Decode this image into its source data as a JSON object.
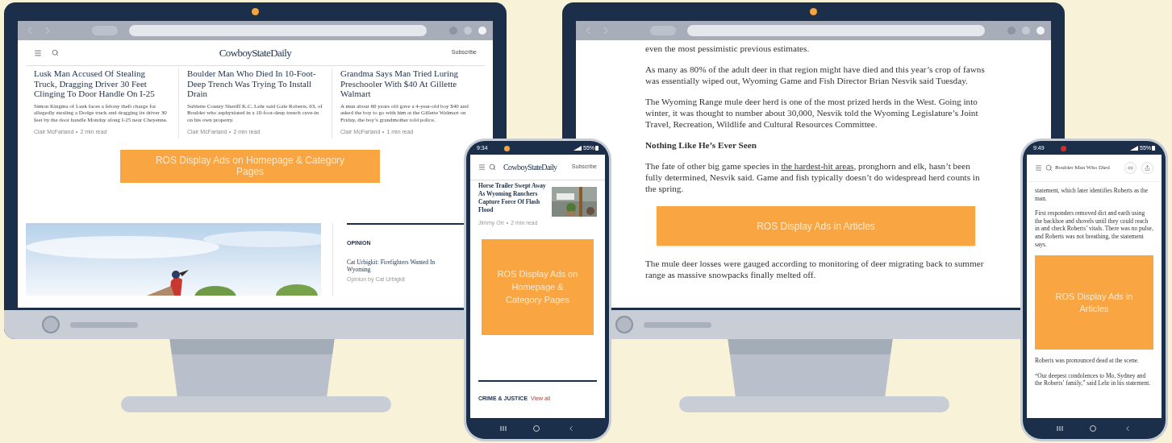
{
  "home_desktop": {
    "logo": "CowboyStateDaily",
    "subscribe": "Subscribe",
    "articles": [
      {
        "title": "Lusk Man Accused Of Stealing Truck, Dragging Driver 30 Feet Clinging To Door Handle On I-25",
        "summary": "Simon Kingma of Lusk faces a felony theft charge for allegedly stealing a Dodge truck and dragging its driver 30 feet by the door handle Monday along I-25 near Cheyenne.",
        "author": "Clair McFarland",
        "read_time": "2 min read"
      },
      {
        "title": "Boulder Man Who Died In 10-Foot-Deep Trench Was Trying To Install Drain",
        "summary": "Sublette County Sheriff K.C. Lehr said Gale Roberts, 63, of Boulder who asphyxiated in a 10-foot-deep trench cave-in on his own property.",
        "author": "Clair McFarland",
        "read_time": "2 min read"
      },
      {
        "title": "Grandma Says Man Tried Luring Preschooler With $40 At Gillette Walmart",
        "summary": "A man about 60 years old gave a 4-year-old boy $40 and asked the boy to go with him at the Gillette Walmart on Friday, the boy’s grandmother told police.",
        "author": "Clair McFarland",
        "read_time": "1 min read"
      }
    ],
    "ad": "ROS Display Ads on Homepage & Category Pages",
    "opinion": {
      "label": "OPINION",
      "title": "Cat Urbigkit: Firefighters Wanted In Wyoming",
      "byline": "Opinion by Cat Urbigkit"
    }
  },
  "article_desktop": {
    "blocks": [
      {
        "kind": "paragraph",
        "text": "even the most pessimistic previous estimates."
      },
      {
        "kind": "paragraph",
        "text": "As many as 80% of the adult deer in that region might have died and this year’s crop of fawns was essentially wiped out, Wyoming Game and Fish Director Brian Nesvik said Tuesday."
      },
      {
        "kind": "paragraph",
        "text": "The Wyoming Range mule deer herd is one of the most prized herds in the West. Going into winter, it was thought to number about 30,000, Nesvik told the Wyoming Legislature’s Joint Travel, Recreation, Wildlife and Cultural Resources Committee."
      },
      {
        "kind": "heading",
        "text": "Nothing Like He’s Ever Seen"
      },
      {
        "kind": "linked_paragraph",
        "before": "The fate of other big game species in ",
        "link": "the hardest-hit areas",
        "after": ", pronghorn and elk, hasn’t been fully determined, Nesvik said. Game and fish typically doesn’t do widespread herd counts in the spring."
      },
      {
        "kind": "ad",
        "text": "ROS Display Ads in Articles"
      },
      {
        "kind": "paragraph",
        "text": "The mule deer losses were gauged according to monitoring of deer migrating back to summer range as massive snowpacks finally melted off."
      }
    ]
  },
  "home_phone": {
    "time": "9:34",
    "battery": "55%",
    "logo": "CowboyStateDaily",
    "subscribe": "Subscribe",
    "article": {
      "title": "Horse Trailer Swept Away As Wyoming Ranchers Capture Force Of Flash Flood",
      "author": "Jimmy Orr",
      "read_time": "2 min read"
    },
    "ad": "ROS Display Ads on Homepage & Category Pages",
    "section": "CRIME & JUSTICE",
    "view_all": "View all"
  },
  "article_phone": {
    "time": "9:49",
    "battery": "55%",
    "title": "Boulder Man Who Died",
    "blocks": [
      {
        "kind": "paragraph",
        "text": "statement, which later identifies Roberts as the man."
      },
      {
        "kind": "paragraph",
        "text": "First responders removed dirt and earth using the backhoe and shovels until they could reach in and check Roberts’ vitals. There was no pulse, and Roberts was not breathing, the statement says."
      },
      {
        "kind": "ad",
        "text": "ROS Display Ads in Articles"
      },
      {
        "kind": "paragraph",
        "text": "Roberts was pronounced dead at the scene."
      },
      {
        "kind": "paragraph",
        "text": "“Our deepest condolences to Mo, Sydney and the Roberts’ family,” said Lehr in his statement."
      }
    ]
  }
}
